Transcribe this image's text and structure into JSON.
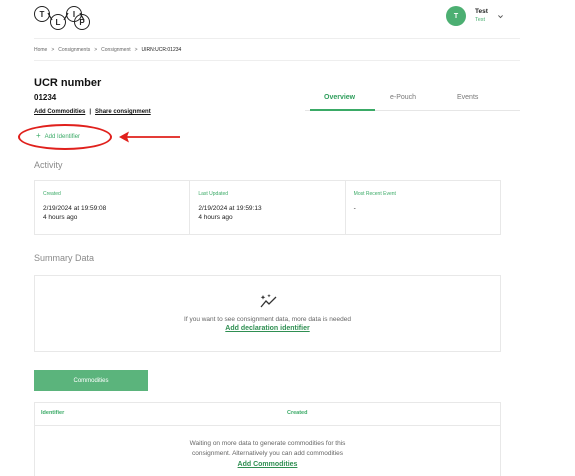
{
  "header": {
    "logo_letters": [
      "T",
      "L",
      "I",
      "P"
    ],
    "avatar_initial": "T",
    "user_name": "Test",
    "user_sub": "Test"
  },
  "breadcrumb": [
    "Home",
    "Consignments",
    "Consignment",
    "UIRN:UCR:01234"
  ],
  "page": {
    "title": "UCR number",
    "ucr_value": "01234",
    "add_commodities_link": "Add Commodities",
    "share_link": "Share consignment",
    "add_identifier": "Add Identifier"
  },
  "tabs": [
    "Overview",
    "e-Pouch",
    "Events"
  ],
  "activity": {
    "heading": "Activity",
    "cells": [
      {
        "label": "Created",
        "value": "2/19/2024 at 19:59:08",
        "sub": "4 hours ago"
      },
      {
        "label": "Last Updated",
        "value": "2/19/2024 at 19:59:13",
        "sub": "4 hours ago"
      },
      {
        "label": "Most Recent Event",
        "value": "-",
        "sub": ""
      }
    ]
  },
  "summary": {
    "heading": "Summary Data",
    "message": "If you want to see consignment data, more data is needed",
    "link": "Add declaration identifier"
  },
  "commodities": {
    "button": "Commodities",
    "columns": [
      "Identifier",
      "Created"
    ],
    "message_line1": "Waiting on more data to generate commodities for this",
    "message_line2": "consignment. Alternatively you can add commodities",
    "link": "Add Commodities"
  },
  "colors": {
    "accent": "#3aaa66",
    "annotation": "#e0201c"
  }
}
